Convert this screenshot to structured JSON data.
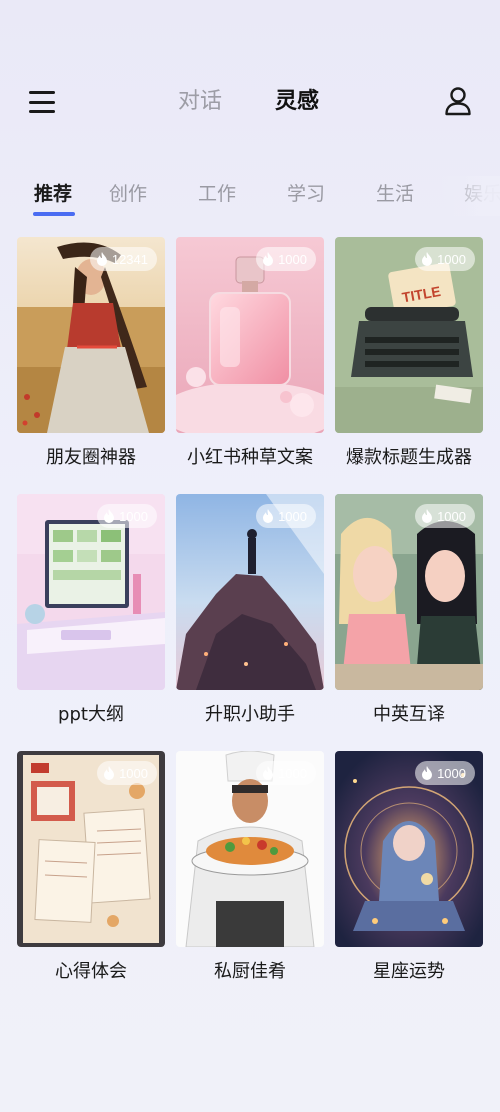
{
  "header": {
    "tab_chat": "对话",
    "tab_inspiration": "灵感",
    "menu_icon": "menu-icon",
    "user_icon": "user-icon"
  },
  "categories": {
    "items": [
      "推荐",
      "创作",
      "工作",
      "学习",
      "生活",
      "娱乐"
    ],
    "active_index": 0
  },
  "cards": [
    {
      "title": "朋友圈神器",
      "count": "12341",
      "image": "girl-in-field-image"
    },
    {
      "title": "小红书种草文案",
      "count": "1000",
      "image": "perfume-bottle-image"
    },
    {
      "title": "爆款标题生成器",
      "count": "1000",
      "image": "typewriter-title-image"
    },
    {
      "title": "ppt大纲",
      "count": "1000",
      "image": "desk-monitor-image"
    },
    {
      "title": "升职小助手",
      "count": "1000",
      "image": "man-on-rock-image"
    },
    {
      "title": "中英互译",
      "count": "1000",
      "image": "two-girls-image"
    },
    {
      "title": "心得体会",
      "count": "1000",
      "image": "notebook-collage-image"
    },
    {
      "title": "私厨佳肴",
      "count": "1000",
      "image": "chef-with-dish-image"
    },
    {
      "title": "星座运势",
      "count": "1000",
      "image": "zodiac-girl-image"
    }
  ],
  "colors": {
    "accent": "#4a6cf2",
    "text_primary": "#1a1a1a",
    "text_muted": "#9a9aa3"
  }
}
